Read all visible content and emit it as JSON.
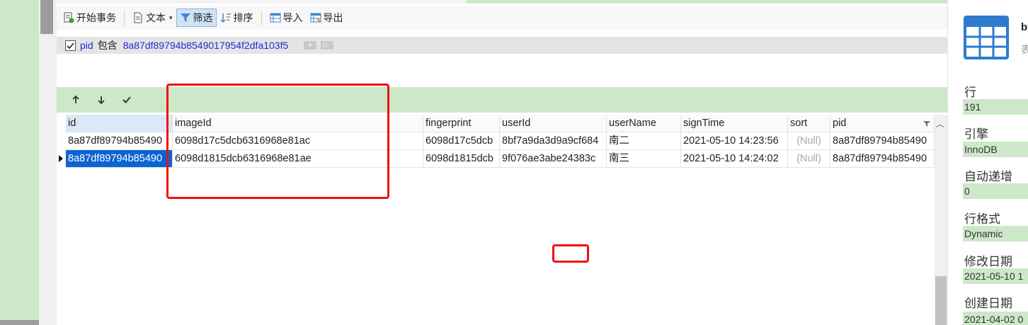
{
  "toolbar": {
    "begin_transaction": "开始事务",
    "text": "文本",
    "filter": "筛选",
    "sort": "排序",
    "import": "导入",
    "export": "导出"
  },
  "filter": {
    "field": "pid",
    "operator": "包含",
    "value": "8a87df89794b8549017954f2dfa103f5",
    "add": "+",
    "checked": true
  },
  "grid": {
    "columns": [
      "id",
      "imageId",
      "fingerprint",
      "userId",
      "userName",
      "signTime",
      "sort",
      "pid"
    ],
    "rows": [
      [
        "8a87df89794b85490",
        "6098d17c5dcb6316968e81ac",
        "6098d17c5dcb",
        "8bf7a9da3d9a9cf684",
        "南二",
        "2021-05-10 14:23:56",
        "(Null)",
        "8a87df89794b85490"
      ],
      [
        "8a87df89794b85490",
        "6098d1815dcb6316968e81ae",
        "6098d1815dcb",
        "9f076ae3abe24383c",
        "南三",
        "2021-05-10 14:24:02",
        "(Null)",
        "8a87df89794b85490"
      ]
    ]
  },
  "panel": {
    "title": "b",
    "subtitle": "表",
    "props": [
      {
        "label": "行",
        "value": "191"
      },
      {
        "label": "引擎",
        "value": "InnoDB"
      },
      {
        "label": "自动递增",
        "value": "0"
      },
      {
        "label": "行格式",
        "value": "Dynamic"
      },
      {
        "label": "修改日期",
        "value": "2021-05-10 1"
      },
      {
        "label": "创建日期",
        "value": "2021-04-02 0"
      }
    ]
  },
  "colors": {
    "accent_green": "#cde8c9",
    "selection_blue": "#0a64d2",
    "annotation_red": "#ee1111",
    "filter_blue": "#1a2fd6"
  }
}
